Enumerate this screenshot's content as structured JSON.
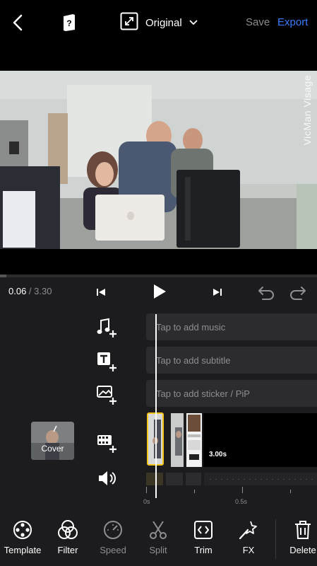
{
  "header": {
    "aspect_label": "Original",
    "save_label": "Save",
    "export_label": "Export"
  },
  "preview": {
    "watermark": "VicMan Visage"
  },
  "player": {
    "current_time": "0.06",
    "separator": " / ",
    "total_time": "3.30",
    "progress_fraction": 0.02
  },
  "tracks": {
    "music_placeholder": "Tap to add music",
    "subtitle_placeholder": "Tap to add subtitle",
    "sticker_placeholder": "Tap to add sticker / PiP"
  },
  "timeline": {
    "cover_label": "Cover",
    "clip_duration": "3.00s",
    "tick_start": "0s",
    "tick_mid": "0.5s"
  },
  "toolbar": {
    "items": [
      {
        "label": "Template",
        "icon": "film-reel-icon",
        "enabled": true
      },
      {
        "label": "Filter",
        "icon": "filter-circles-icon",
        "enabled": true
      },
      {
        "label": "Speed",
        "icon": "speedometer-icon",
        "enabled": false
      },
      {
        "label": "Split",
        "icon": "scissors-icon",
        "enabled": false
      },
      {
        "label": "Trim",
        "icon": "trim-icon",
        "enabled": true
      },
      {
        "label": "FX",
        "icon": "magic-wand-icon",
        "enabled": true
      },
      {
        "label": "Delete",
        "icon": "trash-icon",
        "enabled": true
      }
    ]
  },
  "colors": {
    "accent": "#3a7bff",
    "selection": "#f5c518",
    "panel": "#1c1c1e"
  }
}
